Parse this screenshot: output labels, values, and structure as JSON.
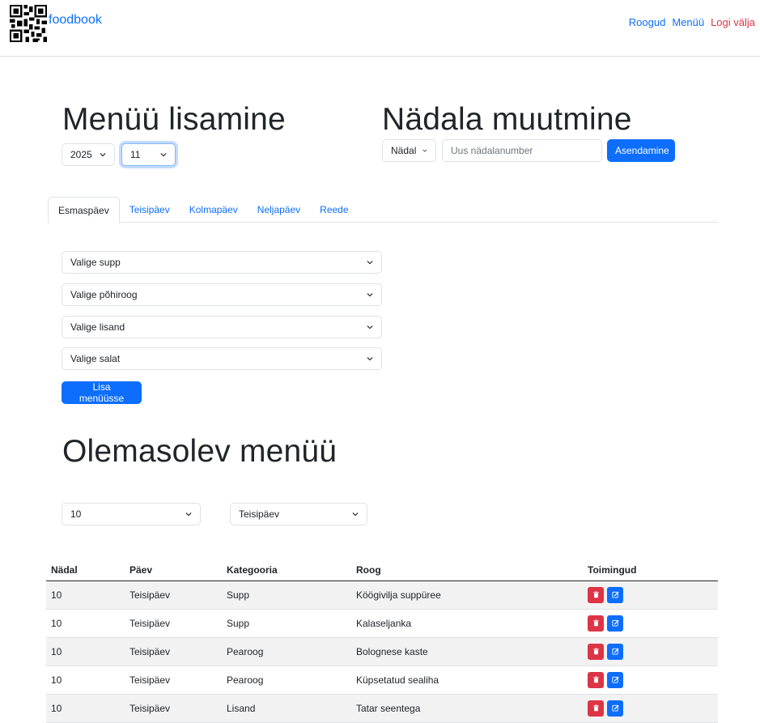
{
  "navbar": {
    "brand": "foodbook",
    "links": [
      "Roogud",
      "Menüü"
    ],
    "logout": "Logi välja"
  },
  "add_menu": {
    "title": "Menüü lisamine",
    "year": "2025",
    "week": "11"
  },
  "week_change": {
    "title": "Nädala muutmine",
    "week_select": "Nädal",
    "new_week_placeholder": "Uus nädalanumber",
    "replace_button": "Asendamine"
  },
  "tabs": [
    "Esmaspäev",
    "Teisipäev",
    "Kolmapäev",
    "Neljapäev",
    "Reede"
  ],
  "active_tab": "Esmaspäev",
  "dish_selects": {
    "soup": "Valige supp",
    "main": "Valige põhiroog",
    "side": "Valige lisand",
    "salad": "Valige salat"
  },
  "add_button": "Lisa menüüsse",
  "existing": {
    "title": "Olemasolev menüü",
    "week_filter": "10",
    "day_filter": "Teisipäev"
  },
  "table": {
    "headers": [
      "Nädal",
      "Päev",
      "Kategooria",
      "Roog",
      "Toimingud"
    ],
    "rows": [
      [
        "10",
        "Teisipäev",
        "Supp",
        "Köögivilja suppüree"
      ],
      [
        "10",
        "Teisipäev",
        "Supp",
        "Kalaseljanka"
      ],
      [
        "10",
        "Teisipäev",
        "Pearoog",
        "Bolognese kaste"
      ],
      [
        "10",
        "Teisipäev",
        "Pearoog",
        "Küpsetatud sealiha"
      ],
      [
        "10",
        "Teisipäev",
        "Lisand",
        "Tatar seentega"
      ]
    ]
  },
  "colors": {
    "primary": "#0d6efd",
    "danger": "#dc3545",
    "text": "#212529"
  },
  "icons": {
    "delete": "trash-icon",
    "edit": "edit-icon",
    "dropdown": "chevron-down-icon"
  }
}
